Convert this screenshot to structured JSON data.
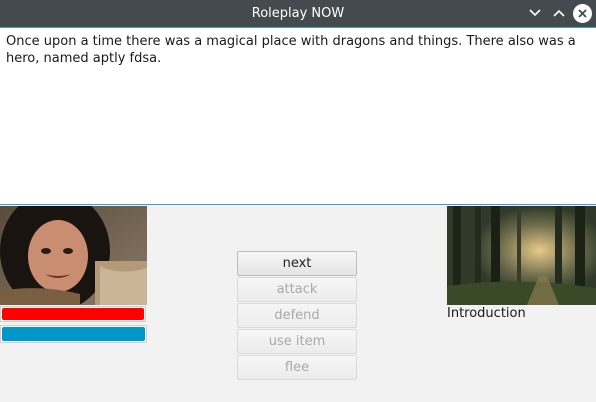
{
  "window": {
    "title": "Roleplay NOW"
  },
  "story": {
    "text": "Once upon a time there was a magical place with dragons and things. There also was a hero, named aptly fdsa."
  },
  "hero": {
    "health": 1.0,
    "mana": 1.0,
    "health_color": "#ff0000",
    "mana_color": "#0096c9"
  },
  "actions": {
    "next": "next",
    "attack": "attack",
    "defend": "defend",
    "use_item": "use item",
    "flee": "flee"
  },
  "scene": {
    "name": "Introduction"
  },
  "icons": [
    "chevron-down-icon",
    "chevron-up-icon",
    "close-icon"
  ]
}
